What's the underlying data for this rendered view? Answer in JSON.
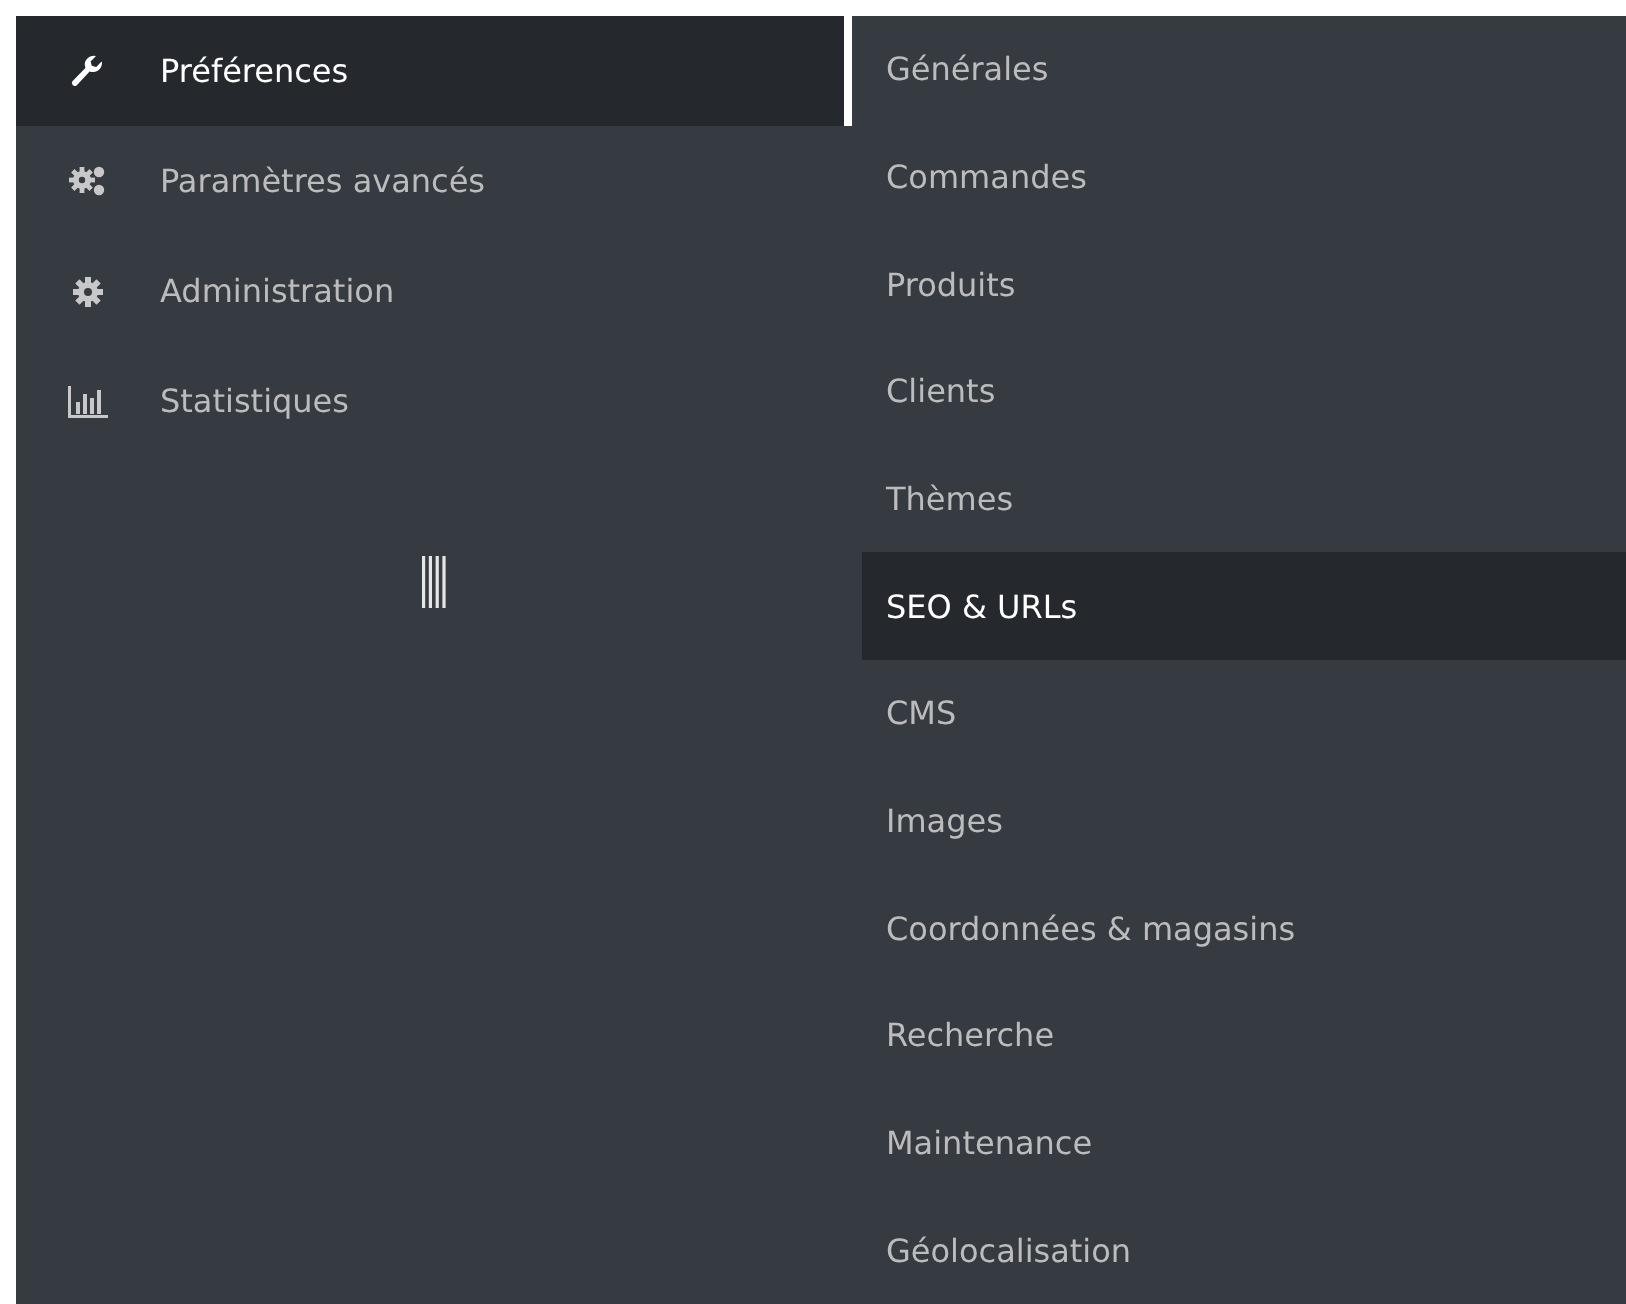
{
  "menu": {
    "items": [
      {
        "label": "Préférences",
        "selected": true
      },
      {
        "label": "Paramètres avancés",
        "selected": false
      },
      {
        "label": "Administration",
        "selected": false
      },
      {
        "label": "Statistiques",
        "selected": false
      }
    ]
  },
  "submenu": {
    "items": [
      {
        "label": "Générales",
        "selected": false
      },
      {
        "label": "Commandes",
        "selected": false
      },
      {
        "label": "Produits",
        "selected": false
      },
      {
        "label": "Clients",
        "selected": false
      },
      {
        "label": "Thèmes",
        "selected": false
      },
      {
        "label": "SEO & URLs",
        "selected": true
      },
      {
        "label": "CMS",
        "selected": false
      },
      {
        "label": "Images",
        "selected": false
      },
      {
        "label": "Coordonnées & magasins",
        "selected": false
      },
      {
        "label": "Recherche",
        "selected": false
      },
      {
        "label": "Maintenance",
        "selected": false
      },
      {
        "label": "Géolocalisation",
        "selected": false
      }
    ]
  }
}
